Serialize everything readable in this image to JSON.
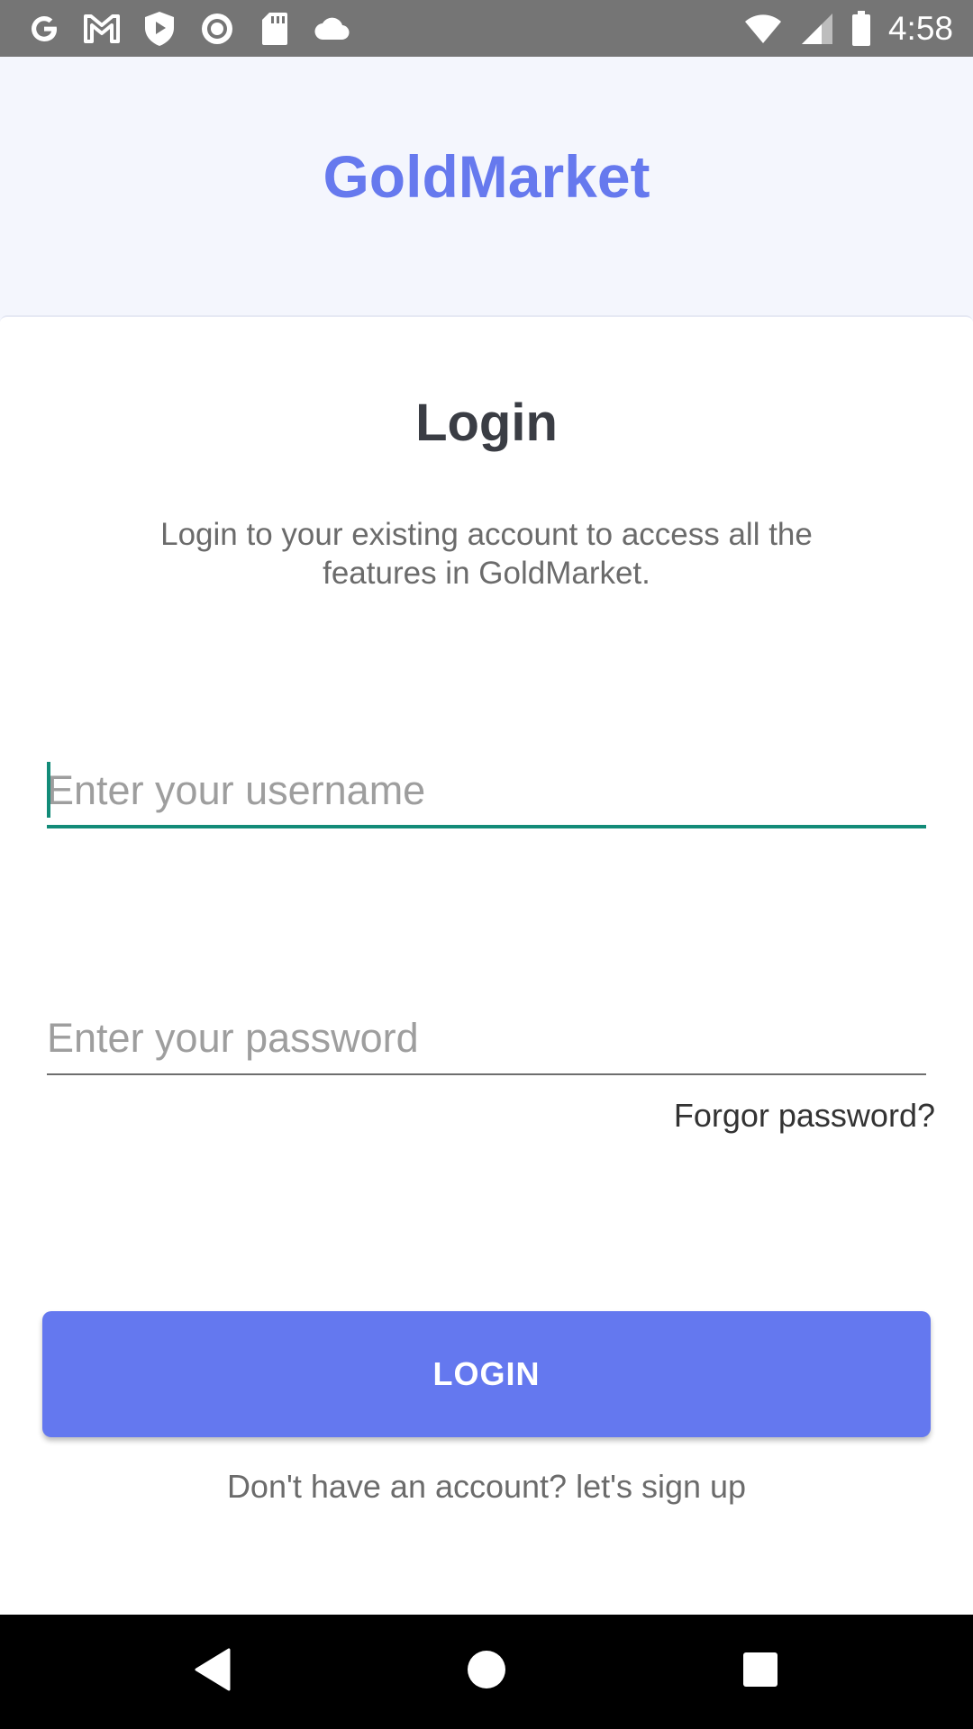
{
  "status_bar": {
    "time": "4:58",
    "left_icons": [
      "google-icon",
      "gmail-icon",
      "shield-play-icon",
      "record-icon",
      "sd-card-icon",
      "cloud-icon"
    ],
    "right_icons": [
      "wifi-icon",
      "cell-signal-icon",
      "battery-icon"
    ]
  },
  "header": {
    "app_title": "GoldMarket",
    "title_color": "#6679ee"
  },
  "login": {
    "title": "Login",
    "subtitle": "Login to your existing account to access all the features in GoldMarket.",
    "username_placeholder": "Enter your username",
    "username_value": "",
    "password_placeholder": "Enter your password",
    "password_value": "",
    "forgot_label": "Forgor password?",
    "button_label": "LOGIN",
    "button_color": "#6478ef",
    "signup_label": "Don't have an account? let's sign up"
  },
  "nav_bar": {
    "icons": [
      "back-icon",
      "home-icon",
      "recents-icon"
    ]
  }
}
